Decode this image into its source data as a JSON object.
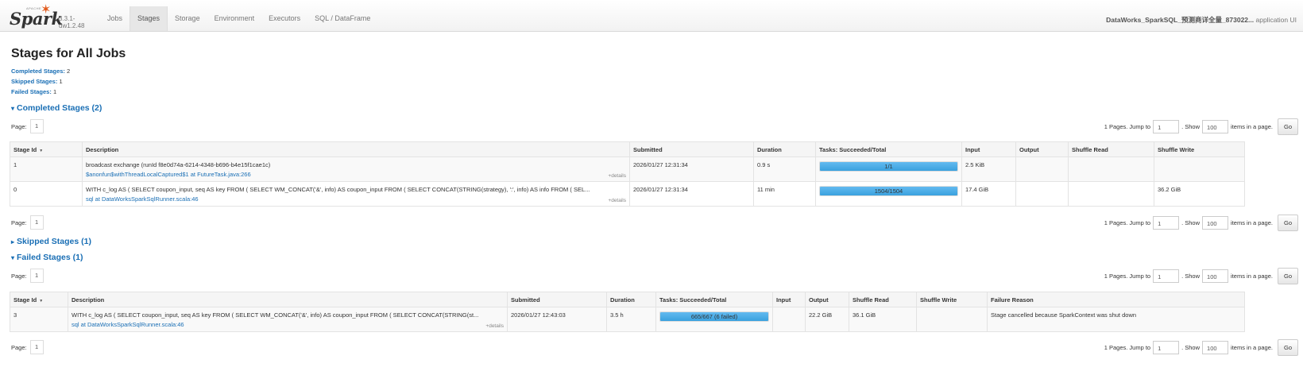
{
  "navbar": {
    "brand": "Spark",
    "apache_text": "APACHE",
    "version": "3.3.1-dw1.2.48",
    "tabs": [
      {
        "label": "Jobs"
      },
      {
        "label": "Stages"
      },
      {
        "label": "Storage"
      },
      {
        "label": "Environment"
      },
      {
        "label": "Executors"
      },
      {
        "label": "SQL / DataFrame"
      }
    ],
    "active_tab": "Stages",
    "app_name": "DataWorks_SparkSQL_预测商详全量_873022...",
    "app_suffix": " application UI"
  },
  "page": {
    "title": "Stages for All Jobs",
    "summary": [
      {
        "label": "Completed Stages:",
        "value": "2"
      },
      {
        "label": "Skipped Stages:",
        "value": "1"
      },
      {
        "label": "Failed Stages:",
        "value": "1"
      }
    ]
  },
  "pager": {
    "page_label": "Page:",
    "page_num": "1",
    "pages_text": "1 Pages. Jump to",
    "jump_value": "1",
    "show_text": ". Show",
    "show_value": "100",
    "items_text": "items in a page.",
    "go_label": "Go"
  },
  "completed": {
    "heading": "Completed Stages (2)",
    "columns": [
      "Stage Id",
      "Description",
      "Submitted",
      "Duration",
      "Tasks: Succeeded/Total",
      "Input",
      "Output",
      "Shuffle Read",
      "Shuffle Write"
    ],
    "rows": [
      {
        "stage_id": "1",
        "desc": "broadcast exchange (runId f8e0d74a-6214-4348-b696-b4e15f1cae1c)",
        "desc_link": "$anonfun$withThreadLocalCaptured$1 at FutureTask.java:266",
        "details": "+details",
        "submitted": "2026/01/27 12:31:34",
        "duration": "0.9 s",
        "tasks": "1/1",
        "progress": 1.0,
        "input": "2.5 KiB",
        "output": "",
        "shuffle_read": "",
        "shuffle_write": ""
      },
      {
        "stage_id": "0",
        "desc": "WITH c_log AS ( SELECT coupon_input, seq AS key FROM ( SELECT WM_CONCAT('&', info) AS coupon_input FROM ( SELECT CONCAT(STRING(strategy), ':', info) AS info FROM ( SEL...",
        "desc_link": "sql at DataWorksSparkSqlRunner.scala:46",
        "details": "+details",
        "submitted": "2026/01/27 12:31:34",
        "duration": "11 min",
        "tasks": "1504/1504",
        "progress": 1.0,
        "input": "17.4 GiB",
        "output": "",
        "shuffle_read": "",
        "shuffle_write": "36.2 GiB"
      }
    ]
  },
  "skipped": {
    "heading": "Skipped Stages (1)"
  },
  "failed": {
    "heading": "Failed Stages (1)",
    "columns": [
      "Stage Id",
      "Description",
      "Submitted",
      "Duration",
      "Tasks: Succeeded/Total",
      "Input",
      "Output",
      "Shuffle Read",
      "Shuffle Write",
      "Failure Reason"
    ],
    "rows": [
      {
        "stage_id": "3",
        "desc": "WITH c_log AS ( SELECT coupon_input, seq AS key FROM ( SELECT WM_CONCAT('&', info) AS coupon_input FROM ( SELECT CONCAT(STRING(st...",
        "desc_link": "sql at DataWorksSparkSqlRunner.scala:46",
        "details": "+details",
        "submitted": "2026/01/27 12:43:03",
        "duration": "3.5 h",
        "tasks": "665/667 (6 failed)",
        "progress": 0.997,
        "input": "",
        "output": "22.2 GiB",
        "shuffle_read": "36.1 GiB",
        "shuffle_write": "",
        "failure_reason": "Stage cancelled because SparkContext was shut down"
      }
    ]
  },
  "colors": {
    "link": "#1a6fb5",
    "progress": "#3aa1de",
    "spark_star": "#e25a1c"
  }
}
